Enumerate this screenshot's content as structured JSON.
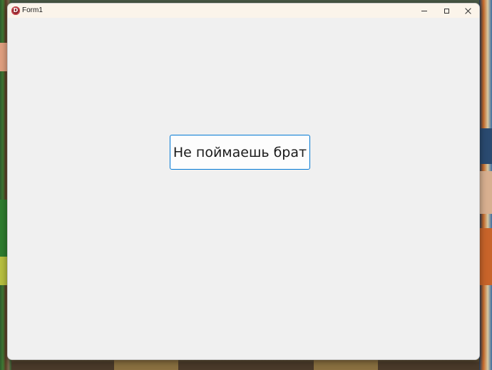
{
  "window": {
    "title": "Form1",
    "icon_letter": "D"
  },
  "form": {
    "button_label": "Не поймаешь брат"
  },
  "icons": {
    "app": "app-logo-icon",
    "minimize": "minimize-icon",
    "maximize": "maximize-icon",
    "close": "close-icon"
  },
  "colors": {
    "titlebar_bg": "#fbf4ea",
    "client_bg": "#f0f0f0",
    "button_border": "#0078d4",
    "app_icon": "#8a1f26"
  }
}
